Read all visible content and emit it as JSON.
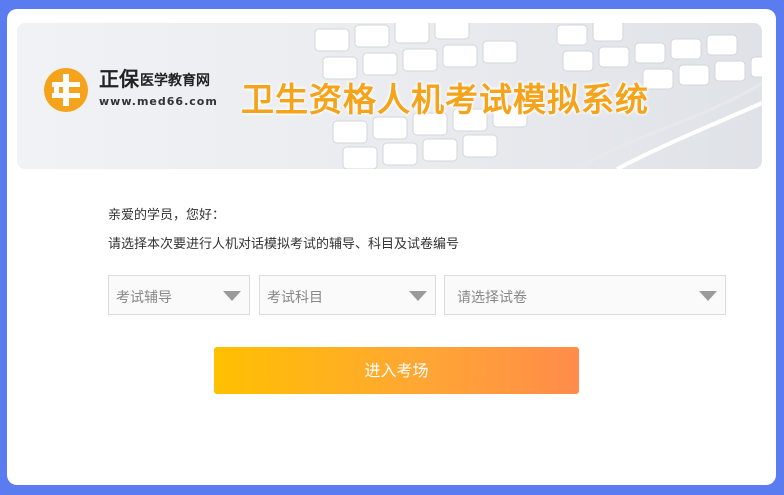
{
  "banner": {
    "brand_main": "正保",
    "brand_sub": "医学教育网",
    "brand_url": "www.med66.com",
    "system_title": "卫生资格人机考试模拟系统",
    "logo_color": "#f5a31a",
    "title_color": "#f5a31a"
  },
  "form": {
    "greeting": "亲爱的学员，您好：",
    "instruction": "请选择本次要进行人机对话模拟考试的辅导、科目及试卷编号",
    "select_course": "考试辅导",
    "select_subject": "考试科目",
    "select_paper": "请选择试卷",
    "enter_button": "进入考场"
  },
  "colors": {
    "page_background": "#5b7cf0",
    "button_gradient_start": "#ffc000",
    "button_gradient_end": "#ff8c4a"
  }
}
